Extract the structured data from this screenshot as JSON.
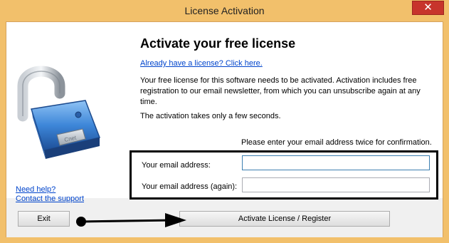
{
  "window": {
    "title": "License Activation",
    "close_label": "✕"
  },
  "content": {
    "heading": "Activate your free license",
    "already_link": "Already have a license? Click here.",
    "description": "Your free license for this software needs to be activated. Activation includes free registration to our email newsletter, from which you can unsubscribe again at any time.",
    "note": "The activation takes only a few seconds.",
    "instruction": "Please enter your email address twice for confirmation."
  },
  "form": {
    "email_label": "Your email address:",
    "email_value": "",
    "email_again_label": "Your email address (again):",
    "email_again_value": ""
  },
  "footer": {
    "need_help": "Need help?",
    "contact_support": "Contact the support",
    "exit_label": "Exit",
    "activate_label": "Activate License / Register"
  },
  "lock_engraving": "Cnet",
  "icons": [
    "open-padlock-icon",
    "close-icon",
    "arrow-annotation-icon"
  ]
}
